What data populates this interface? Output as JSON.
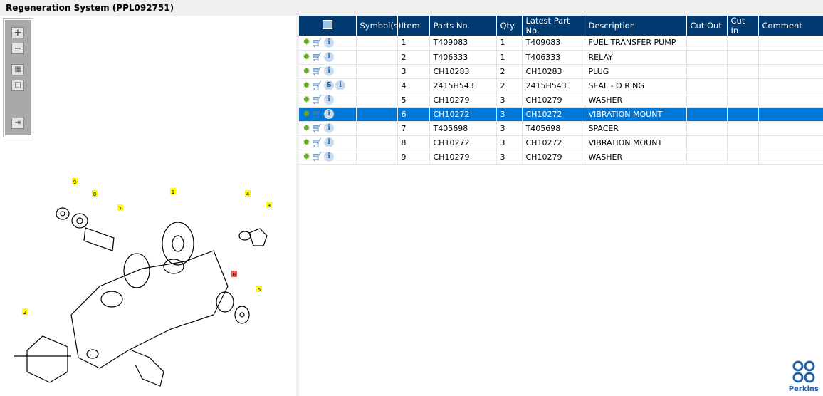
{
  "title": "Regeneration System (PPL092751)",
  "columns": [
    "",
    "Symbol(s)",
    "Item",
    "Parts No.",
    "Qty.",
    "Latest Part No.",
    "Description",
    "Cut Out",
    "Cut In",
    "Comment"
  ],
  "rows": [
    {
      "item": "1",
      "part": "T409083",
      "qty": "1",
      "latest": "T409083",
      "desc": "FUEL TRANSFER PUMP",
      "s": false
    },
    {
      "item": "2",
      "part": "T406333",
      "qty": "1",
      "latest": "T406333",
      "desc": "RELAY",
      "s": false
    },
    {
      "item": "3",
      "part": "CH10283",
      "qty": "2",
      "latest": "CH10283",
      "desc": "PLUG",
      "s": false
    },
    {
      "item": "4",
      "part": "2415H543",
      "qty": "2",
      "latest": "2415H543",
      "desc": "SEAL - O RING",
      "s": true
    },
    {
      "item": "5",
      "part": "CH10279",
      "qty": "3",
      "latest": "CH10279",
      "desc": "WASHER",
      "s": false
    },
    {
      "item": "6",
      "part": "CH10272",
      "qty": "3",
      "latest": "CH10272",
      "desc": "VIBRATION MOUNT",
      "s": false,
      "selected": true
    },
    {
      "item": "7",
      "part": "T405698",
      "qty": "3",
      "latest": "T405698",
      "desc": "SPACER",
      "s": false
    },
    {
      "item": "8",
      "part": "CH10272",
      "qty": "3",
      "latest": "CH10272",
      "desc": "VIBRATION MOUNT",
      "s": false
    },
    {
      "item": "9",
      "part": "CH10279",
      "qty": "3",
      "latest": "CH10279",
      "desc": "WASHER",
      "s": false
    }
  ],
  "callouts": [
    "9",
    "8",
    "7",
    "1",
    "4",
    "3",
    "6",
    "5",
    "2"
  ],
  "logo": "Perkins",
  "selected_color": "#0078d7"
}
